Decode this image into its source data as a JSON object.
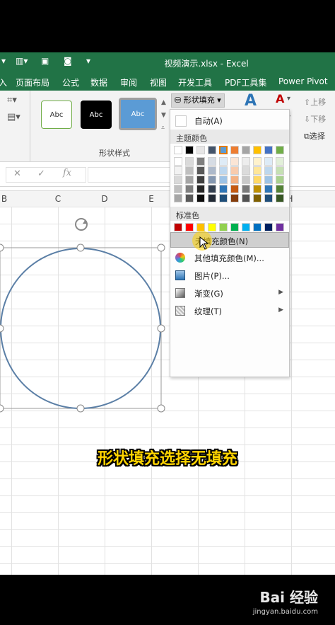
{
  "window": {
    "title": "视频演示.xlsx - Excel"
  },
  "ribbon_tabs": [
    "页面布局",
    "公式",
    "数据",
    "审阅",
    "视图",
    "开发工具",
    "PDF工具集",
    "Power Pivot"
  ],
  "ribbon": {
    "styles": [
      "Abc",
      "Abc",
      "Abc"
    ],
    "group_label": "形状样式",
    "fill_button": "形状填充",
    "side_buttons": [
      "上移",
      "下移",
      "选择"
    ]
  },
  "formula_bar": {
    "fx": "fx"
  },
  "columns": [
    "B",
    "C",
    "D",
    "E",
    "H"
  ],
  "menu": {
    "auto": "自动(A)",
    "theme_header": "主题颜色",
    "theme_colors": [
      [
        "#FFFFFF",
        "#D9D9D9",
        "#7F7F7F",
        "#D6DCE4",
        "#DEEBF6",
        "#FBE5D5",
        "#EDEDED",
        "#FFF2CC",
        "#DDEBF7",
        "#E2EFD9"
      ],
      [
        "#F2F2F2",
        "#BFBFBF",
        "#595959",
        "#ADB9CA",
        "#BDD7EE",
        "#F8CBAD",
        "#DBDBDB",
        "#FFE699",
        "#BDD7EE",
        "#C5E0B3"
      ],
      [
        "#D9D9D9",
        "#A6A6A6",
        "#404040",
        "#8497B0",
        "#9DC3E6",
        "#F4B183",
        "#C9C9C9",
        "#FFD966",
        "#9DC3E6",
        "#A9D18E"
      ],
      [
        "#BFBFBF",
        "#808080",
        "#262626",
        "#333F4F",
        "#2E75B6",
        "#C55A11",
        "#7B7B7B",
        "#BF9000",
        "#2E75B6",
        "#538135"
      ],
      [
        "#A6A6A6",
        "#595959",
        "#0D0D0D",
        "#222A35",
        "#1F4E79",
        "#843C0C",
        "#525252",
        "#7F6000",
        "#1F4E79",
        "#375623"
      ]
    ],
    "theme_top": [
      "#FFFFFF",
      "#000000",
      "#E7E6E6",
      "#44546A",
      "#5B9BD5",
      "#ED7D31",
      "#A5A5A5",
      "#FFC000",
      "#4472C4",
      "#70AD47"
    ],
    "standard_header": "标准色",
    "standard_colors": [
      "#C00000",
      "#FF0000",
      "#FFC000",
      "#FFFF00",
      "#92D050",
      "#00B050",
      "#00B0F0",
      "#0070C0",
      "#002060",
      "#7030A0"
    ],
    "no_fill": "无填充颜色(N)",
    "more_colors": "其他填充颜色(M)...",
    "picture": "图片(P)...",
    "gradient": "渐变(G)",
    "texture": "纹理(T)"
  },
  "caption": "形状填充选择无填充",
  "watermark": {
    "logo": "Bai 经验",
    "url": "jingyan.baidu.com"
  },
  "colors": {
    "excel_green": "#217346",
    "shape_outline": "#5B7FA6",
    "highlight": "#FFD400"
  }
}
